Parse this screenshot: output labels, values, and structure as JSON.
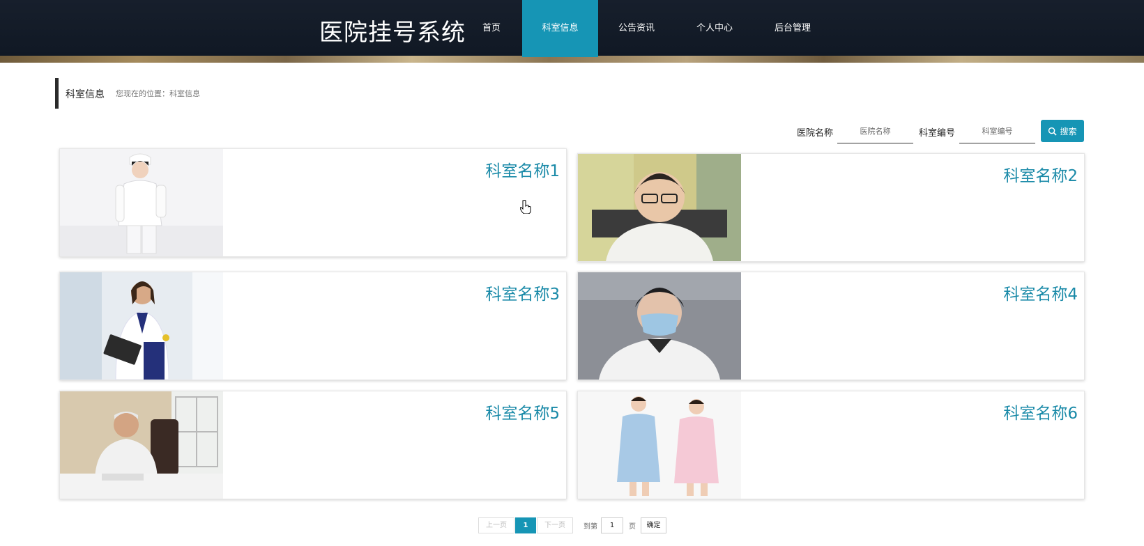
{
  "header": {
    "title": "医院挂号系统",
    "nav": [
      {
        "label": "首页",
        "active": false
      },
      {
        "label": "科室信息",
        "active": true
      },
      {
        "label": "公告资讯",
        "active": false
      },
      {
        "label": "个人中心",
        "active": false
      },
      {
        "label": "后台管理",
        "active": false
      }
    ]
  },
  "breadcrumb": {
    "title": "科室信息",
    "position": "您现在的位置：科室信息"
  },
  "search": {
    "hospital_label": "医院名称",
    "hospital_placeholder": "医院名称",
    "dept_label": "科室编号",
    "dept_placeholder": "科室编号",
    "button_label": "搜索"
  },
  "cards": [
    {
      "title": "科室名称1",
      "image": "nurse-photo"
    },
    {
      "title": "科室名称2",
      "image": "doctor-photo"
    },
    {
      "title": "科室名称3",
      "image": "doctor-photo"
    },
    {
      "title": "科室名称4",
      "image": "doctor-photo"
    },
    {
      "title": "科室名称5",
      "image": "doctor-photo"
    },
    {
      "title": "科室名称6",
      "image": "nurse-photo"
    }
  ],
  "pagination": {
    "prev_label": "上一页",
    "current_page": "1",
    "next_label": "下一页",
    "goto_label": "到第",
    "goto_value": "1",
    "page_suffix": "页",
    "confirm_label": "确定"
  },
  "colors": {
    "accent": "#1695b5",
    "nav_bg": "#141c28",
    "card_title": "#1a8aa8"
  }
}
